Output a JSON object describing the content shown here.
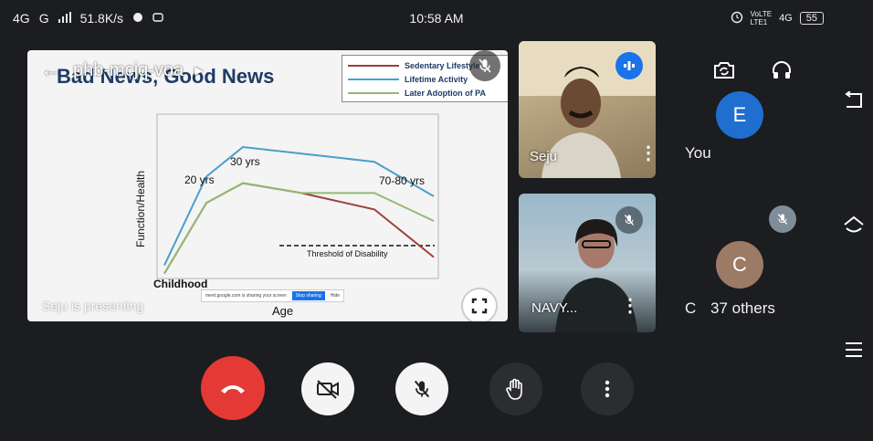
{
  "status_bar": {
    "network": "4G",
    "signal": "G",
    "speed": "51.8K/s",
    "time": "10:58 AM",
    "carrier_top": "VoLTE",
    "carrier_bottom": "LTE1",
    "net_type": "4G",
    "battery": "55"
  },
  "meeting": {
    "code": "phb-mcjq-voa",
    "presenting_text": "Seju is presenting"
  },
  "slide": {
    "title": "Bad News, Good News"
  },
  "chart_data": {
    "type": "line",
    "xlabel": "Age",
    "ylabel": "Function/Health",
    "x_points": [
      "Childhood",
      "20 yrs",
      "30 yrs",
      "",
      "70-80 yrs",
      ""
    ],
    "ylim": [
      0,
      100
    ],
    "series": [
      {
        "name": "Sedentary Lifestyle",
        "color": "#a0403c",
        "values": [
          3,
          46,
          58,
          52,
          42,
          13
        ]
      },
      {
        "name": "Lifetime Activity",
        "color": "#4a9fcb",
        "values": [
          8,
          62,
          80,
          76,
          71,
          50
        ]
      },
      {
        "name": "Later Adoption of PA",
        "color": "#93b978",
        "values": [
          3,
          46,
          58,
          52,
          52,
          35
        ]
      }
    ],
    "annotations": {
      "label_20": "20 yrs",
      "label_30": "30 yrs",
      "label_7080": "70-80 yrs",
      "label_childhood": "Childhood",
      "threshold": "Threshold of Disability",
      "threshold_value": 20
    }
  },
  "participants": {
    "seju_name": "Seju",
    "navy_name": "NAVY...",
    "you_initial": "E",
    "you_label": "You",
    "others_initial": "C",
    "others_partial": "C",
    "others_label": "37 others"
  },
  "colors": {
    "end_call": "#e53935",
    "you_avatar": "#1f6fd1",
    "others_avatar": "#9b7a66"
  }
}
